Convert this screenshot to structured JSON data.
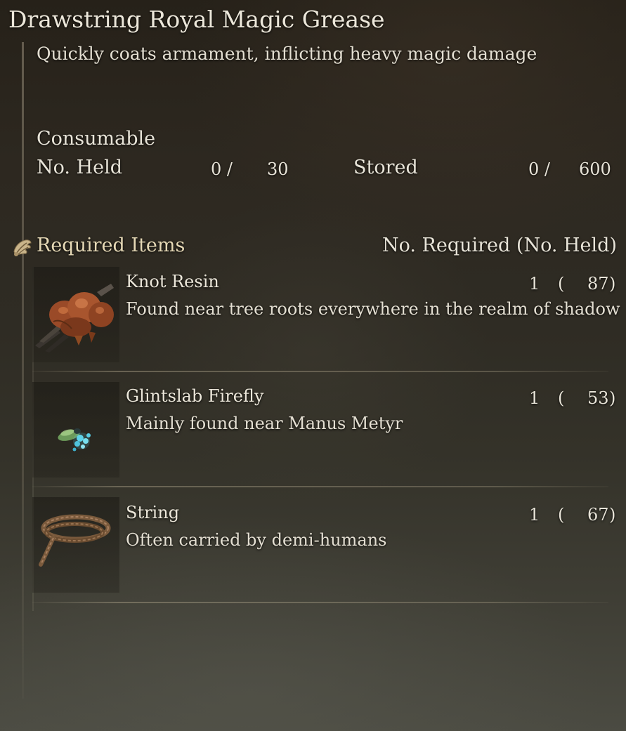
{
  "item": {
    "title": "Drawstring Royal Magic Grease",
    "description": "Quickly coats armament, inflicting heavy magic damage",
    "category": "Consumable"
  },
  "inventory": {
    "held_label": "No. Held",
    "held": "0 /",
    "held_max": "30",
    "stored_label": "Stored",
    "stored": "0 /",
    "stored_max": "600"
  },
  "requirements": {
    "label": "Required Items",
    "header": "No. Required (No. Held)",
    "icon": "crafting-hand-icon",
    "items": [
      {
        "name": "Knot Resin",
        "description": "Found near tree roots everywhere in the realm of shadow",
        "required": "1",
        "open": "(",
        "held": "87",
        "close": ")",
        "icon": "knot-resin-icon"
      },
      {
        "name": "Glintslab Firefly",
        "description": "Mainly found near Manus Metyr",
        "required": "1",
        "open": "(",
        "held": "53",
        "close": ")",
        "icon": "glintslab-firefly-icon"
      },
      {
        "name": "String",
        "description": "Often carried by demi-humans",
        "required": "1",
        "open": "(",
        "held": "67",
        "close": ")",
        "icon": "string-coil-icon"
      }
    ]
  }
}
